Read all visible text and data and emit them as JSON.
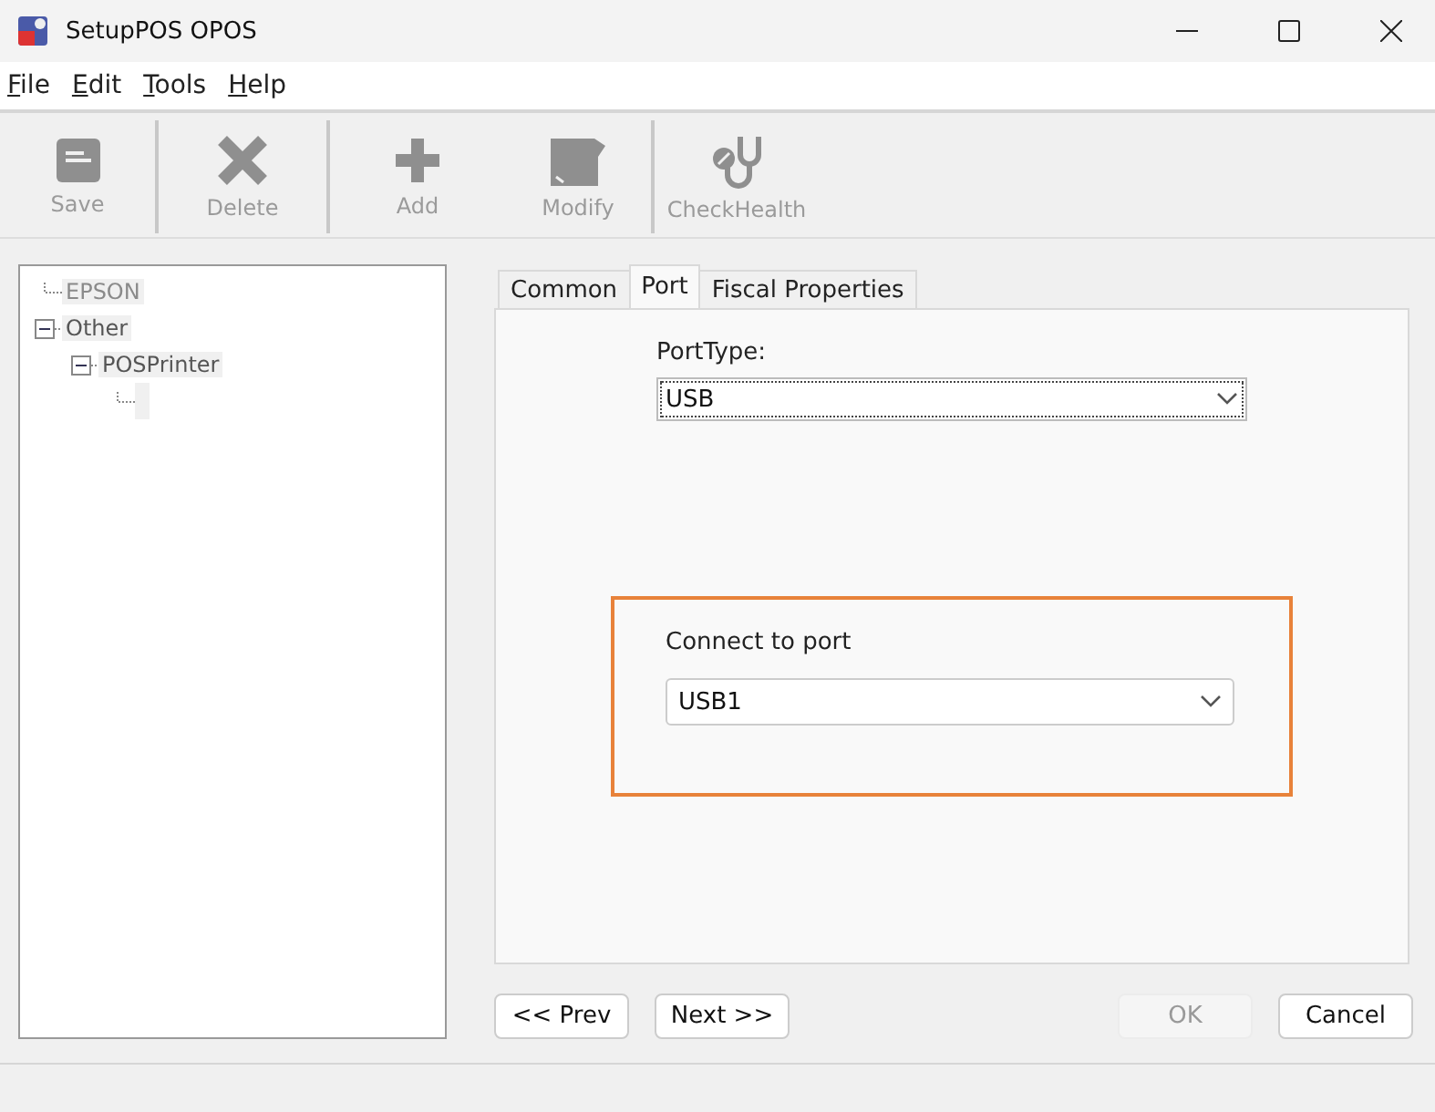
{
  "window": {
    "title": "SetupPOS OPOS"
  },
  "menu": [
    {
      "label": "File"
    },
    {
      "label": "Edit"
    },
    {
      "label": "Tools"
    },
    {
      "label": "Help"
    }
  ],
  "toolbar": [
    {
      "label": "Save",
      "kind": "save",
      "disabled": true,
      "separator_after": true
    },
    {
      "label": "Delete",
      "kind": "delete",
      "disabled": true,
      "separator_after": true
    },
    {
      "label": "Add",
      "kind": "add",
      "disabled": true,
      "separator_after": false
    },
    {
      "label": "Modify",
      "kind": "modify",
      "disabled": true,
      "separator_after": true
    },
    {
      "label": "CheckHealth",
      "kind": "checkhealth",
      "disabled": true,
      "separator_after": false
    }
  ],
  "tree": [
    {
      "label": "EPSON"
    },
    {
      "label": "Other",
      "expanded": true,
      "children": [
        {
          "label": "POSPrinter",
          "expanded": true,
          "children": [
            {
              "kind": "blank"
            }
          ]
        }
      ]
    }
  ],
  "tabs": [
    {
      "label": "Common",
      "selected": false
    },
    {
      "label": "Port",
      "selected": true
    },
    {
      "label": "Fiscal Properties",
      "selected": false
    }
  ],
  "port_type": {
    "label": "PortType:",
    "value": "USB"
  },
  "connect_port": {
    "label": "Connect to port",
    "value": "USB1",
    "highlighted": true
  },
  "buttons": [
    {
      "label": "<< Prev",
      "disabled": false
    },
    {
      "label": "Next >>",
      "disabled": false
    },
    {
      "label": "OK",
      "disabled": true
    },
    {
      "label": "Cancel",
      "disabled": false
    }
  ]
}
